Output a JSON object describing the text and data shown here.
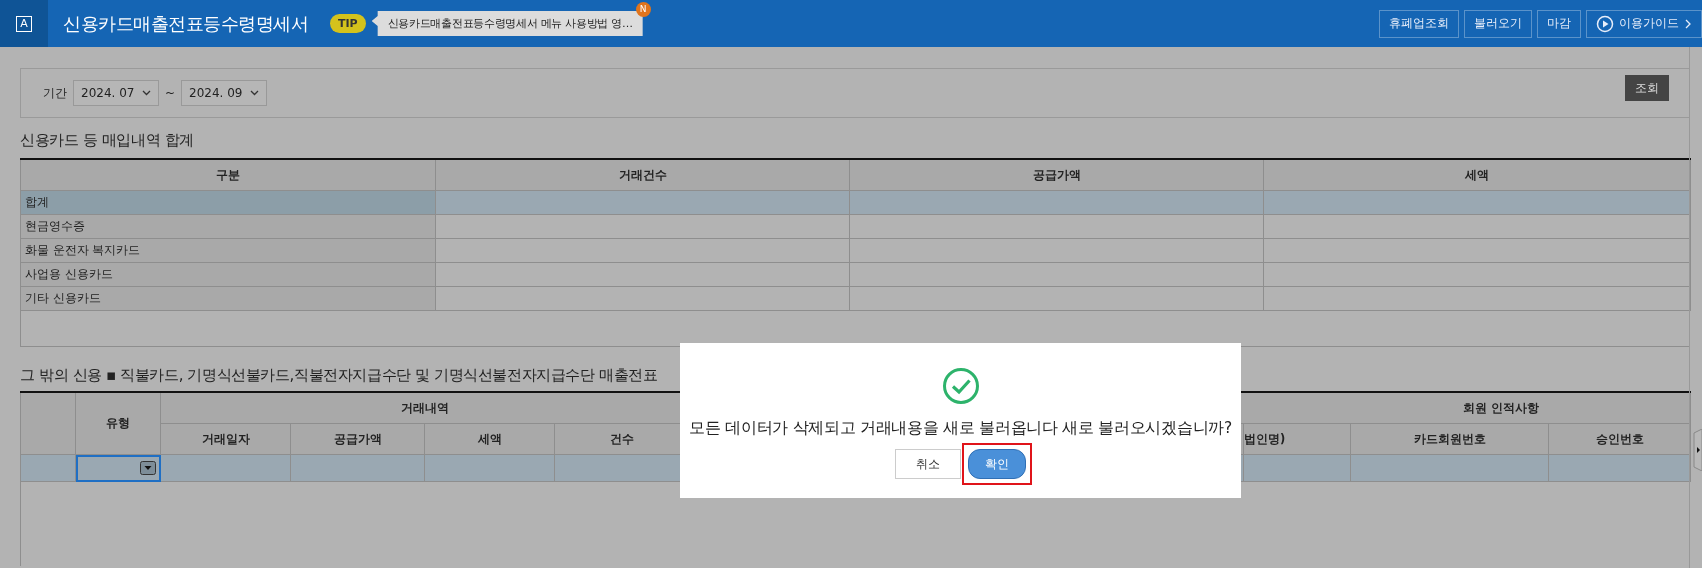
{
  "header": {
    "logo": "A",
    "title": "신용카드매출전표등수령명세서",
    "tip_badge": "TIP",
    "tip_text": "신용카드매출전표등수령명세서 메뉴 사용방법 영…",
    "notice_badge": "N",
    "buttons": [
      {
        "label": "휴폐업조회",
        "kind": "plain"
      },
      {
        "label": "불러오기",
        "kind": "plain"
      },
      {
        "label": "마감",
        "kind": "plain"
      },
      {
        "label": "이용가이드",
        "kind": "guide"
      }
    ]
  },
  "filter": {
    "label": "기간",
    "from": "2024. 07",
    "separator": "~",
    "to": "2024. 09",
    "search_button": "조회"
  },
  "summary": {
    "title": "신용카드 등 매입내역 합계",
    "columns": [
      "구분",
      "거래건수",
      "공급가액",
      "세액"
    ],
    "rows": [
      {
        "label": "합계",
        "selected": true
      },
      {
        "label": "현금영수증",
        "selected": false
      },
      {
        "label": "화물 운전자 복지카드",
        "selected": false
      },
      {
        "label": "사업용 신용카드",
        "selected": false
      },
      {
        "label": "기타 신용카드",
        "selected": false
      }
    ]
  },
  "detail": {
    "title": "그 밖의 신용 ▪ 직불카드, 기명식선불카드,직불전자지급수단 및 기명식선불전자지급수단 매출전표",
    "type_header": "유형",
    "groups": [
      "거래내역",
      "회원 인적사항"
    ],
    "left_columns": [
      "거래일자",
      "공급가액",
      "세액",
      "건수"
    ],
    "right_columns": [
      "법인명)",
      "카드회원번호",
      "승인번호"
    ],
    "rows": [
      {
        "selected": true
      }
    ]
  },
  "dialog": {
    "message": "모든 데이터가 삭제되고 거래내용을 새로 불러옵니다 새로 불러오시겠습니까?",
    "buttons": [
      {
        "label": "취소",
        "kind": "cancel",
        "highlighted": false
      },
      {
        "label": "확인",
        "kind": "confirm",
        "highlighted": true
      }
    ]
  }
}
